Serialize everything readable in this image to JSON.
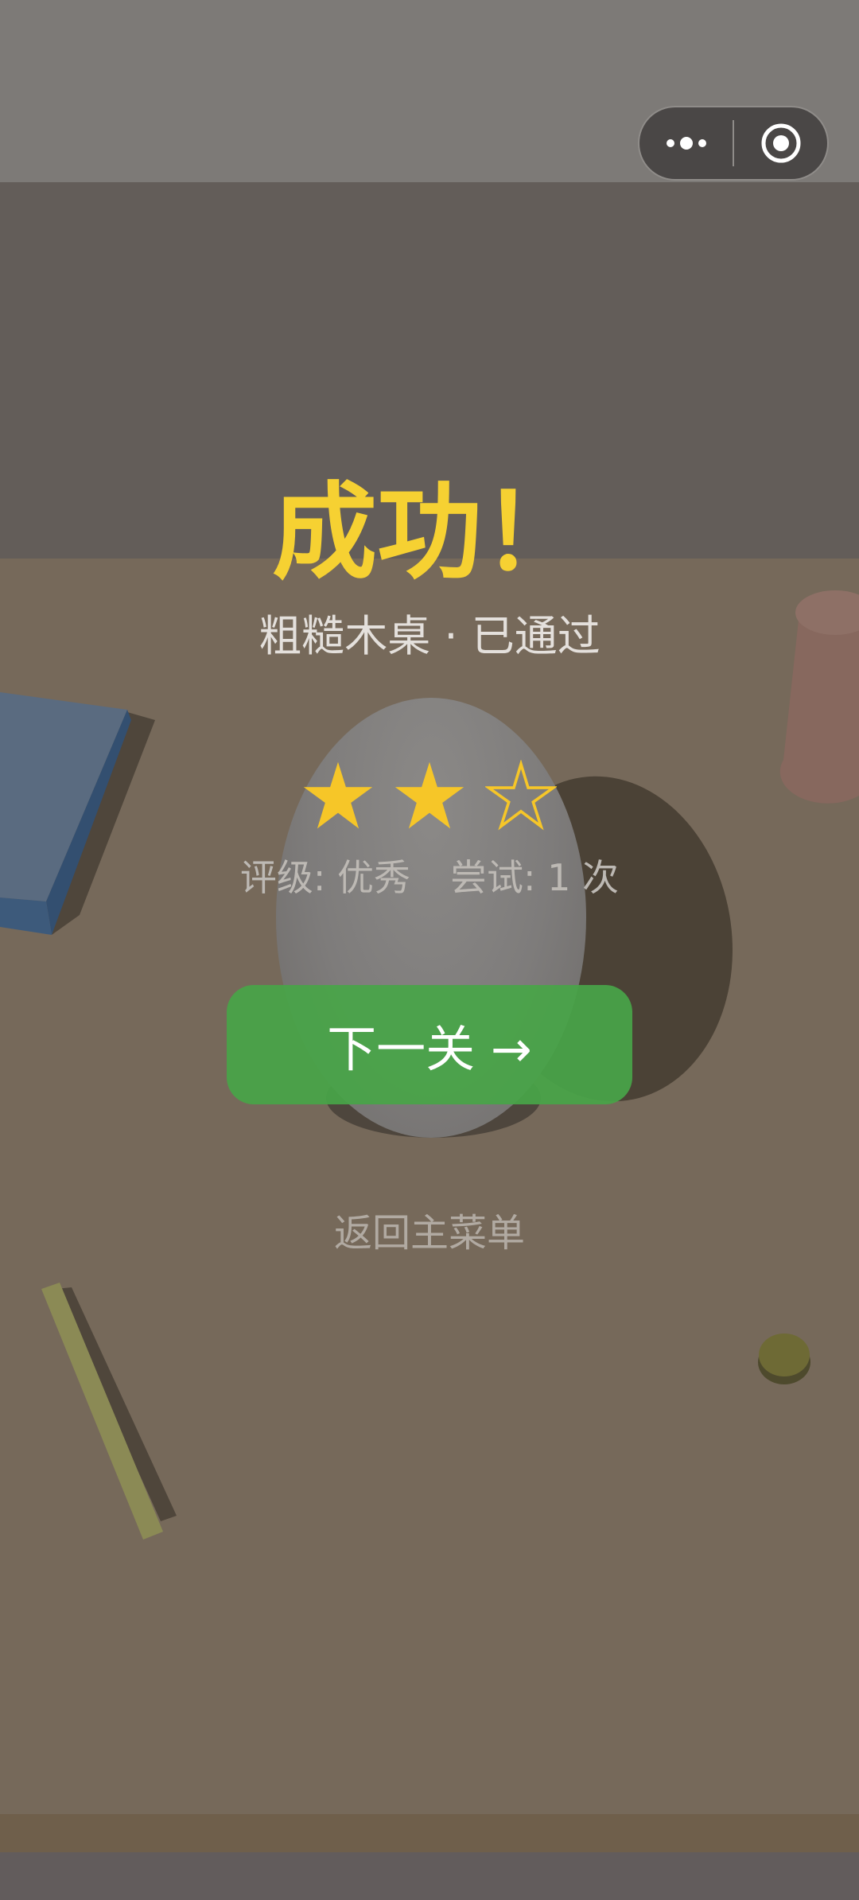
{
  "result": {
    "title": "成功！",
    "level_name": "粗糙木桌",
    "separator": "·",
    "status": "已通过",
    "stars_earned": 2,
    "stars_total": 3,
    "rating_label": "评级:",
    "rating_value": "优秀",
    "attempts_label": "尝试:",
    "attempts_value": "1 次"
  },
  "actions": {
    "next_label": "下一关 →",
    "menu_label": "返回主菜单"
  },
  "colors": {
    "title": "#f6d132",
    "star_filled": "#f6c628",
    "next_button": "#48a548"
  },
  "icons": {
    "capsule_more": "more-dots-icon",
    "capsule_close": "target-circle-icon"
  }
}
